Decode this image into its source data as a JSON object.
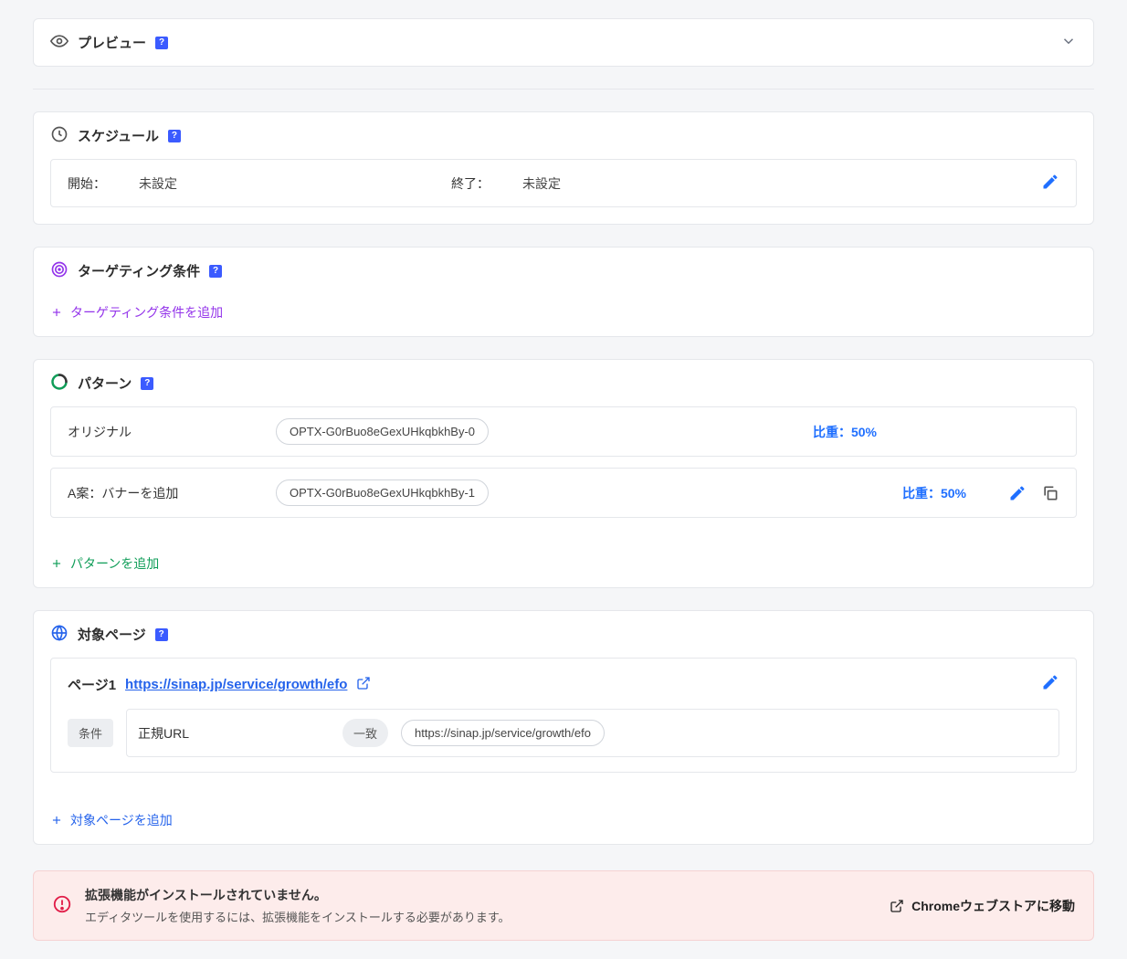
{
  "preview": {
    "title": "プレビュー"
  },
  "schedule": {
    "title": "スケジュール",
    "start_label": "開始：",
    "start_value": "未設定",
    "end_label": "終了：",
    "end_value": "未設定"
  },
  "targeting": {
    "title": "ターゲティング条件",
    "add_label": "ターゲティング条件を追加"
  },
  "patterns": {
    "title": "パターン",
    "add_label": "パターンを追加",
    "rows": [
      {
        "name": "オリジナル",
        "code": "OPTX-G0rBuo8eGexUHkqbkhBy-0",
        "weight": "比重：50%"
      },
      {
        "name": "A案：バナーを追加",
        "code": "OPTX-G0rBuo8eGexUHkqbkhBy-1",
        "weight": "比重：50%"
      }
    ]
  },
  "target_pages": {
    "title": "対象ページ",
    "add_label": "対象ページを追加",
    "page": {
      "label": "ページ1",
      "url": "https://sinap.jp/service/growth/efo",
      "condition_tag": "条件",
      "field": "正規URL",
      "match": "一致",
      "value": "https://sinap.jp/service/growth/efo"
    }
  },
  "alert": {
    "title": "拡張機能がインストールされていません。",
    "sub": "エディタツールを使用するには、拡張機能をインストールする必要があります。",
    "action": "Chromeウェブストアに移動"
  }
}
